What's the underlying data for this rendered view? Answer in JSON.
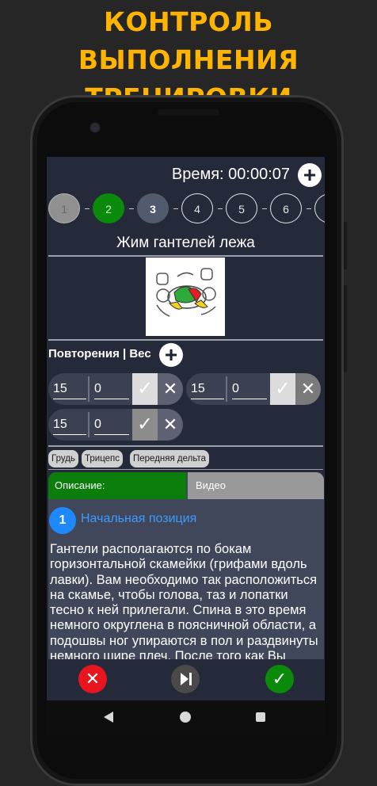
{
  "promo": {
    "line1": "КОНТРОЛЬ ВЫПОЛНЕНИЯ",
    "line2": "ТРЕНИРОВКИ"
  },
  "header": {
    "time_text": "Время: 00:00:07",
    "add_icon": "plus-icon"
  },
  "steps": [
    "1",
    "2",
    "3",
    "4",
    "5",
    "6"
  ],
  "exercise": {
    "title": "Жим гантелей лежа"
  },
  "reps": {
    "label": "Повторения | Вес"
  },
  "sets": [
    {
      "reps": "15",
      "weight": "0",
      "done": true
    },
    {
      "reps": "15",
      "weight": "0",
      "done": true
    },
    {
      "reps": "15",
      "weight": "0",
      "done": false
    }
  ],
  "muscles": [
    "Грудь",
    "Трицепс",
    "Передняя дельта"
  ],
  "tabs": {
    "description": "Описание:",
    "video": "Видео"
  },
  "instruction": {
    "number": "1",
    "heading": "Начальная позиция",
    "text": "Гантели располагаются по бокам горизонтальной скамейки (грифами вдоль лавки). Вам необходимо так расположиться на скамье, чтобы голова, таз и лопатки тесно к ней прилегали. Спина в это время немного округлена в поясничной области, а подошвы ног упираются в пол и раздвинуты немного шире плеч. После того как Вы"
  },
  "colors": {
    "accent": "#FFB400",
    "green": "#0B8A0B",
    "red": "#E8141E",
    "link": "#3D9BFF"
  }
}
